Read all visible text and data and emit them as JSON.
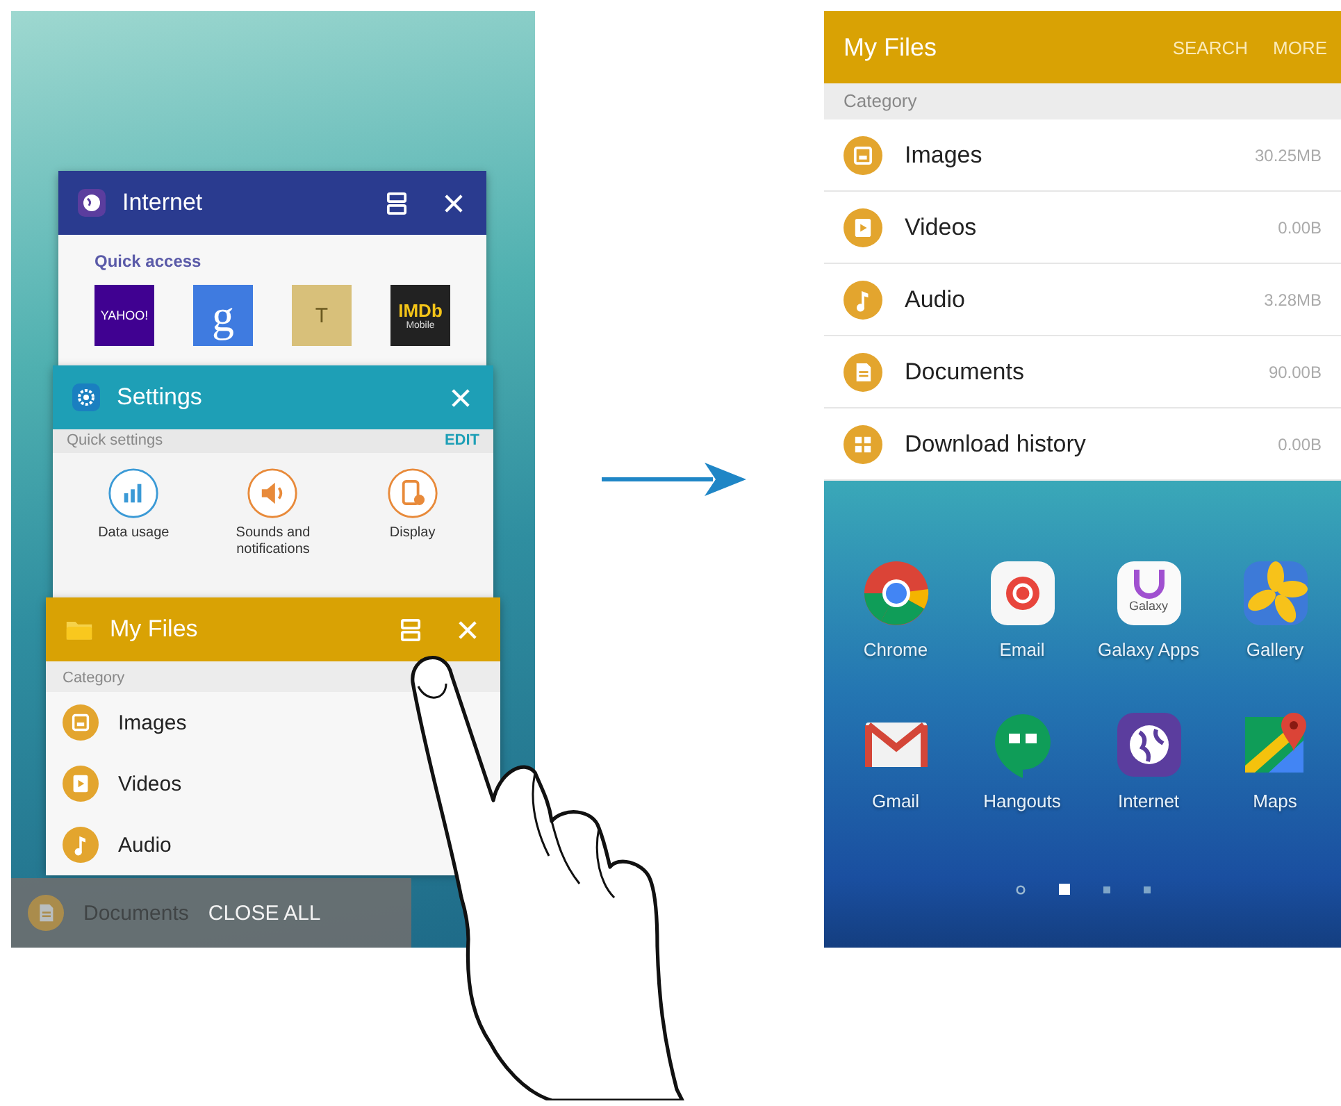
{
  "left_screen": {
    "recent_apps": [
      {
        "kind": "internet",
        "title": "Internet",
        "split": true,
        "section_label": "Quick access",
        "shortcuts": [
          {
            "text": "YAHOO!",
            "color": "#400191"
          },
          {
            "text": "g",
            "color": "#3f7be0"
          },
          {
            "text": "T",
            "color": "#d8c07a"
          },
          {
            "text": "IMDb",
            "subtext": "Mobile",
            "color": "#222222"
          }
        ]
      },
      {
        "kind": "settings",
        "title": "Settings",
        "split": false,
        "section_label": "Quick settings",
        "action": "EDIT",
        "quick_settings": [
          {
            "kind": "data",
            "label": "Data usage"
          },
          {
            "kind": "sound",
            "label": "Sounds and notifications"
          },
          {
            "kind": "display",
            "label": "Display"
          }
        ]
      },
      {
        "kind": "files",
        "title": "My Files",
        "split": true,
        "section_label": "Category",
        "categories": [
          {
            "kind": "image",
            "name": "Images"
          },
          {
            "kind": "video",
            "name": "Videos"
          },
          {
            "kind": "audio",
            "name": "Audio"
          }
        ]
      }
    ],
    "close_all": {
      "label": "CLOSE ALL",
      "row_behind": {
        "kind": "document",
        "name": "Documents"
      }
    }
  },
  "right_screen": {
    "app_bar": {
      "title": "My Files",
      "actions": [
        "SEARCH",
        "MORE"
      ]
    },
    "section_label": "Category",
    "categories": [
      {
        "kind": "image",
        "name": "Images",
        "size": "30.25MB"
      },
      {
        "kind": "video",
        "name": "Videos",
        "size": "0.00B"
      },
      {
        "kind": "audio",
        "name": "Audio",
        "size": "3.28MB"
      },
      {
        "kind": "document",
        "name": "Documents",
        "size": "90.00B"
      },
      {
        "kind": "download",
        "name": "Download history",
        "size": "0.00B"
      }
    ],
    "home_apps": [
      {
        "kind": "chrome",
        "label": "Chrome"
      },
      {
        "kind": "email",
        "label": "Email"
      },
      {
        "kind": "galaxy",
        "label": "Galaxy Apps",
        "icon_text": "Galaxy"
      },
      {
        "kind": "gallery",
        "label": "Gallery"
      },
      {
        "kind": "gmail",
        "label": "Gmail"
      },
      {
        "kind": "hangouts",
        "label": "Hangouts"
      },
      {
        "kind": "internet",
        "label": "Internet"
      },
      {
        "kind": "maps",
        "label": "Maps"
      }
    ],
    "page_indicators": [
      {
        "kind": "home",
        "selected": false
      },
      {
        "kind": "page",
        "selected": true
      },
      {
        "kind": "page",
        "selected": false
      },
      {
        "kind": "page",
        "selected": false
      }
    ]
  }
}
